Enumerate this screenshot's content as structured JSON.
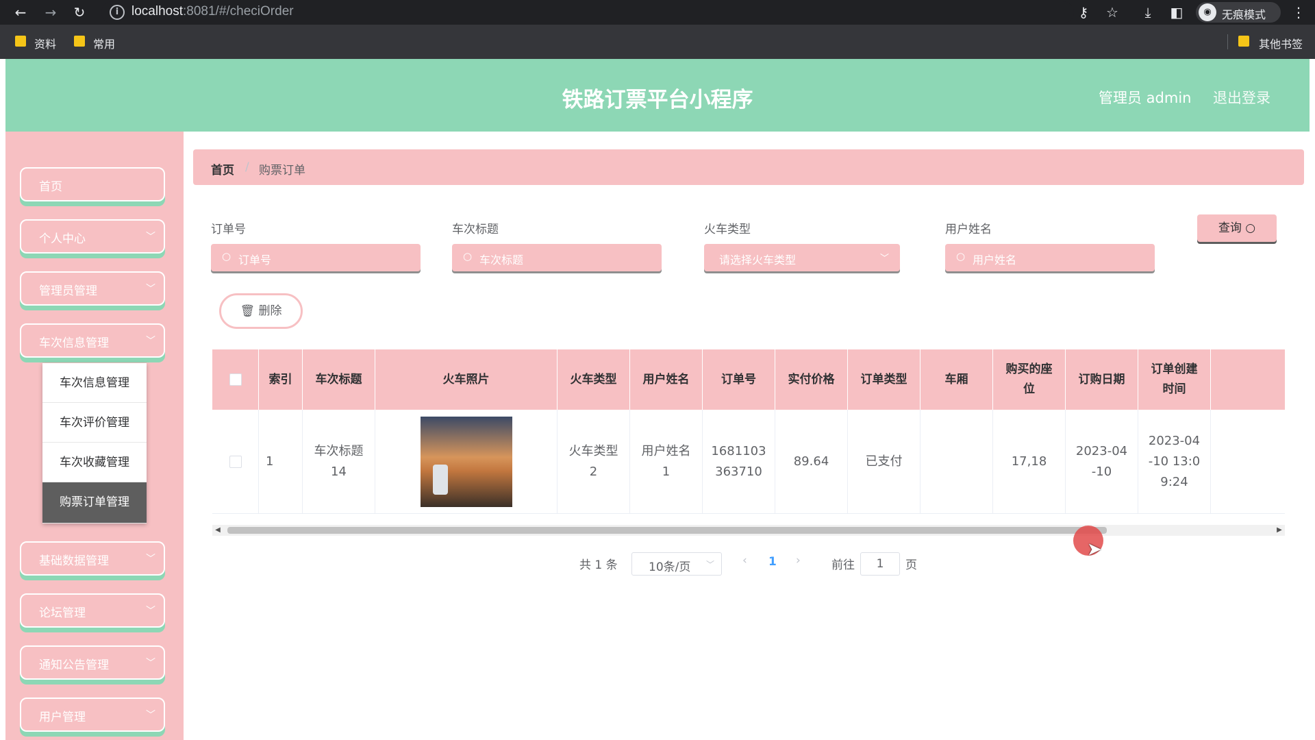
{
  "browser": {
    "url_host": "localhost",
    "url_rest": ":8081/#/checiOrder",
    "incognito_label": "无痕模式",
    "bookmarks": [
      "资料",
      "常用"
    ],
    "other_bookmarks": "其他书签"
  },
  "header": {
    "title": "铁路订票平台小程序",
    "admin": "管理员 admin",
    "logout": "退出登录",
    "accent_color": "#8dd7b5",
    "theme_color": "#f7c0c3"
  },
  "sidebar": {
    "items": [
      {
        "label": "首页",
        "has_chevron": false
      },
      {
        "label": "个人中心",
        "has_chevron": true
      },
      {
        "label": "管理员管理",
        "has_chevron": true
      },
      {
        "label": "车次信息管理",
        "has_chevron": true
      },
      {
        "label": "基础数据管理",
        "has_chevron": true
      },
      {
        "label": "论坛管理",
        "has_chevron": true
      },
      {
        "label": "通知公告管理",
        "has_chevron": true
      },
      {
        "label": "用户管理",
        "has_chevron": true
      }
    ],
    "submenu": [
      "车次信息管理",
      "车次评价管理",
      "车次收藏管理",
      "购票订单管理"
    ],
    "submenu_active": "购票订单管理"
  },
  "breadcrumb": {
    "home": "首页",
    "sep": "/",
    "current": "购票订单"
  },
  "search": {
    "fields": [
      {
        "label": "订单号",
        "placeholder": "订单号"
      },
      {
        "label": "车次标题",
        "placeholder": "车次标题"
      },
      {
        "label": "火车类型",
        "placeholder": "请选择火车类型"
      },
      {
        "label": "用户姓名",
        "placeholder": "用户姓名"
      }
    ],
    "query_button": "查询"
  },
  "actions": {
    "delete": "删除"
  },
  "table": {
    "headers": [
      "索引",
      "车次标题",
      "火车照片",
      "火车类型",
      "用户姓名",
      "订单号",
      "实付价格",
      "订单类型",
      "车厢",
      "购买的座\n位",
      "订购日期",
      "订单创建\n时间"
    ],
    "rows": [
      {
        "index": "1",
        "title": "车次标题\n14",
        "train_type": "火车类型\n2",
        "user_name": "用户姓名\n1",
        "order_no": "1681103\n363710",
        "price": "89.64",
        "order_type": "已支付",
        "carriage": "",
        "seat": "17,18",
        "order_date": "2023-04\n-10",
        "create_time": "2023-04\n-10 13:0\n9:24"
      }
    ]
  },
  "pagination": {
    "total": "共 1 条",
    "page_size": "10条/页",
    "current_page": "1",
    "goto_prefix": "前往",
    "goto_value": "1",
    "goto_suffix": "页"
  }
}
